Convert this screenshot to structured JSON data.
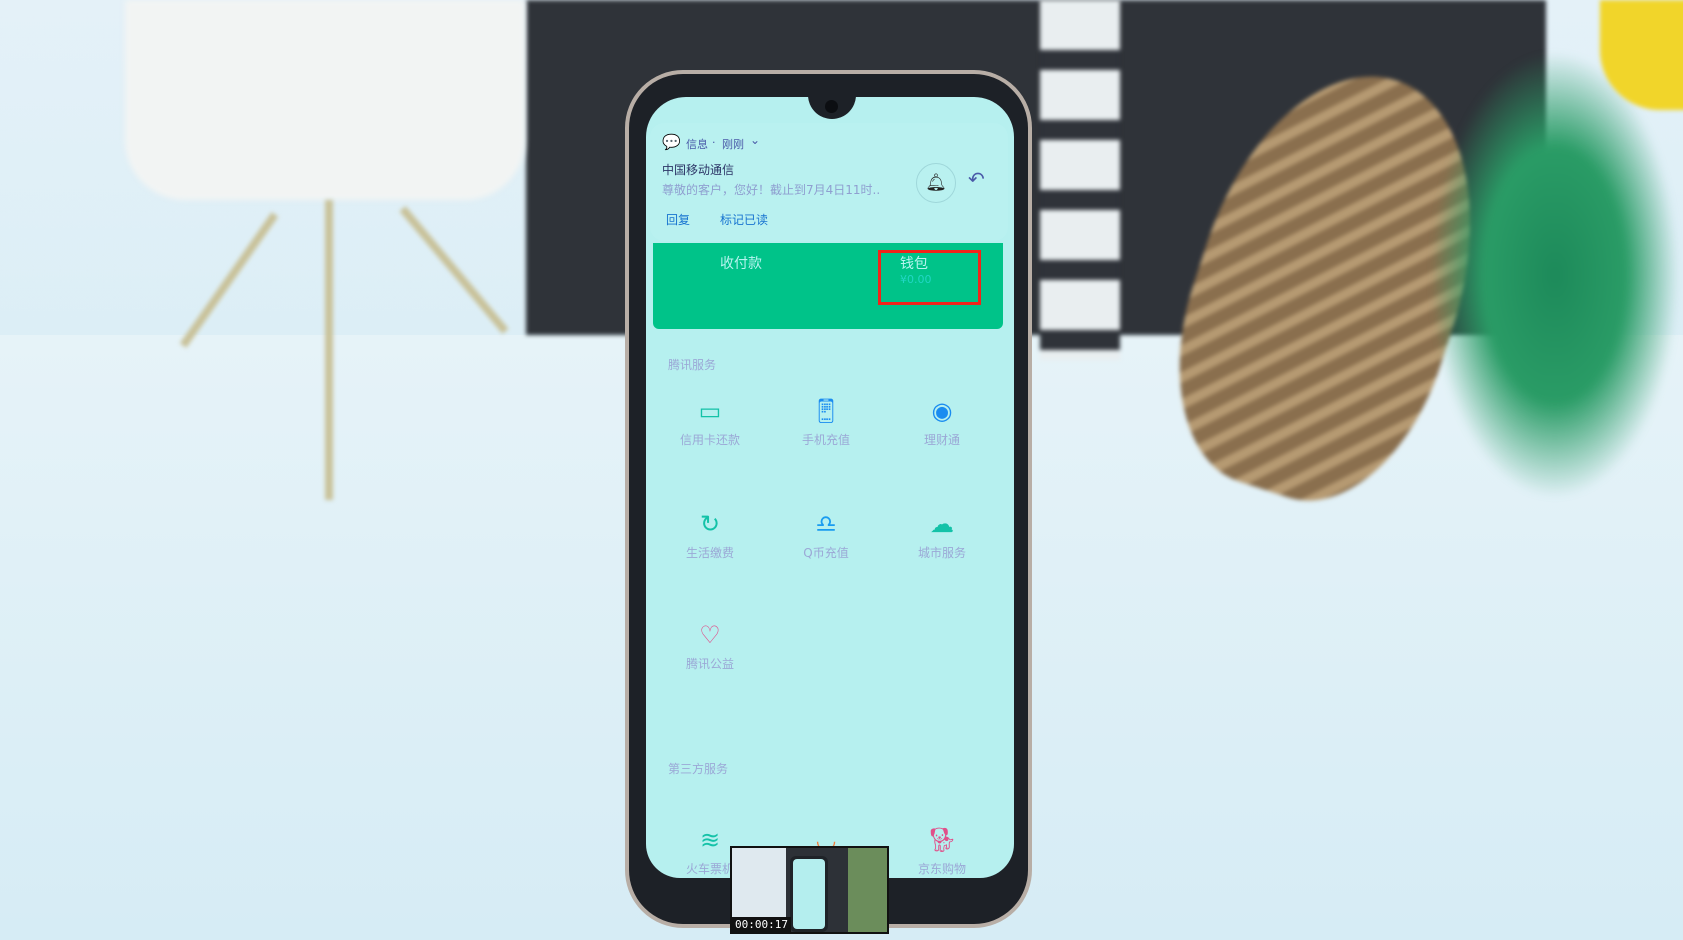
{
  "notification": {
    "app": "信息",
    "time": "刚刚",
    "sender": "中国移动通信",
    "preview": "尊敬的客户，您好！截止到7月4日11时..",
    "actions": [
      "回复",
      "标记已读"
    ]
  },
  "banner": {
    "pay_label": "收付款",
    "wallet_label": "钱包",
    "wallet_balance": "¥0.00",
    "color": "#00c389",
    "highlight_color": "#f2231a"
  },
  "tencent_services": {
    "title": "腾讯服务",
    "items": [
      {
        "label": "信用卡还款",
        "icon": "credit-card-icon"
      },
      {
        "label": "手机充值",
        "icon": "phone-recharge-icon"
      },
      {
        "label": "理财通",
        "icon": "wealth-icon"
      },
      {
        "label": "生活缴费",
        "icon": "utility-bill-icon"
      },
      {
        "label": "Q币充值",
        "icon": "qq-penguin-icon"
      },
      {
        "label": "城市服务",
        "icon": "city-service-icon"
      },
      {
        "label": "腾讯公益",
        "icon": "charity-heart-icon"
      }
    ]
  },
  "third_party_services": {
    "title": "第三方服务",
    "items": [
      {
        "label": "火车票机",
        "icon": "train-icon"
      },
      {
        "label": "",
        "icon": "didi-icon"
      },
      {
        "label": "京东购物",
        "icon": "jd-dog-icon"
      }
    ]
  },
  "video_thumbnail": {
    "timestamp": "00:00:17"
  }
}
